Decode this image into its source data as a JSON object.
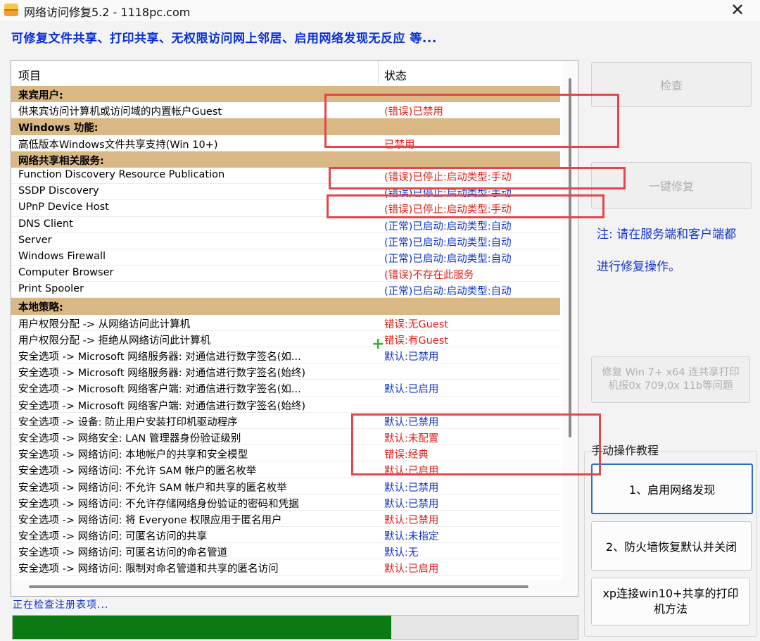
{
  "window": {
    "title": "网络访问修复5.2 - 1118pc.com",
    "close_glyph": "✕"
  },
  "subtitle": "可修复文件共享、打印共享、无权限访问网上邻居、启用网络发现无反应  等...",
  "list": {
    "columns": {
      "item": "项目",
      "status": "状态"
    },
    "rows": [
      {
        "type": "group",
        "item": "来宾用户:",
        "status": "",
        "color": ""
      },
      {
        "type": "row",
        "item": "供来宾访问计算机或访问域的内置帐户Guest",
        "status": "(错误)已禁用",
        "color": "red"
      },
      {
        "type": "group",
        "item": "Windows 功能:",
        "status": "",
        "color": ""
      },
      {
        "type": "row",
        "item": "高低版本Windows文件共享支持(Win 10+)",
        "status": "已禁用",
        "color": "red"
      },
      {
        "type": "group",
        "item": "网络共享相关服务:",
        "status": "",
        "color": ""
      },
      {
        "type": "row",
        "item": "Function Discovery Resource Publication",
        "status": "(错误)已停止:启动类型:手动",
        "color": "red"
      },
      {
        "type": "row",
        "item": "SSDP Discovery",
        "status": "(错误)已停止:启动类型:手动",
        "color": "blue"
      },
      {
        "type": "row",
        "item": "UPnP Device Host",
        "status": "(错误)已停止:启动类型:手动",
        "color": "red"
      },
      {
        "type": "row",
        "item": "DNS Client",
        "status": "(正常)已启动:启动类型:自动",
        "color": "blue"
      },
      {
        "type": "row",
        "item": "Server",
        "status": "(正常)已启动:启动类型:自动",
        "color": "blue"
      },
      {
        "type": "row",
        "item": "Windows Firewall",
        "status": "(正常)已启动:启动类型:自动",
        "color": "blue"
      },
      {
        "type": "row",
        "item": "Computer Browser",
        "status": "(错误)不存在此服务",
        "color": "red"
      },
      {
        "type": "row",
        "item": "Print Spooler",
        "status": "(正常)已启动:启动类型:自动",
        "color": "blue"
      },
      {
        "type": "group",
        "item": "本地策略:",
        "status": "",
        "color": ""
      },
      {
        "type": "row",
        "item": "用户权限分配 -> 从网络访问此计算机",
        "status": "错误:无Guest",
        "color": "red"
      },
      {
        "type": "row",
        "item": "用户权限分配 -> 拒绝从网络访问此计算机",
        "status": "错误:有Guest",
        "color": "red"
      },
      {
        "type": "row",
        "item": "安全选项 -> Microsoft 网络服务器: 对通信进行数字签名(如...",
        "status": "默认:已禁用",
        "color": "blue"
      },
      {
        "type": "row",
        "item": "安全选项 -> Microsoft 网络服务器: 对通信进行数字签名(始终)",
        "status": "",
        "color": ""
      },
      {
        "type": "row",
        "item": "安全选项 -> Microsoft 网络客户端: 对通信进行数字签名(如...",
        "status": "默认:已启用",
        "color": "blue"
      },
      {
        "type": "row",
        "item": "安全选项 -> Microsoft 网络客户端: 对通信进行数字签名(始终)",
        "status": "",
        "color": ""
      },
      {
        "type": "row",
        "item": "安全选项 -> 设备: 防止用户安装打印机驱动程序",
        "status": "默认:已禁用",
        "color": "blue"
      },
      {
        "type": "row",
        "item": "安全选项 -> 网络安全: LAN 管理器身份验证级别",
        "status": "默认:未配置",
        "color": "red"
      },
      {
        "type": "row",
        "item": "安全选项 -> 网络访问: 本地帐户的共享和安全模型",
        "status": "错误:经典",
        "color": "red"
      },
      {
        "type": "row",
        "item": "安全选项 -> 网络访问: 不允许 SAM 帐户的匿名枚举",
        "status": "默认:已启用",
        "color": "red"
      },
      {
        "type": "row",
        "item": "安全选项 -> 网络访问: 不允许 SAM 帐户和共享的匿名枚举",
        "status": "默认:已禁用",
        "color": "blue"
      },
      {
        "type": "row",
        "item": "安全选项 -> 网络访问: 不允许存储网络身份验证的密码和凭据",
        "status": "默认:已禁用",
        "color": "blue"
      },
      {
        "type": "row",
        "item": "安全选项 -> 网络访问: 将 Everyone 权限应用于匿名用户",
        "status": "默认:已禁用",
        "color": "red"
      },
      {
        "type": "row",
        "item": "安全选项 -> 网络访问: 可匿名访问的共享",
        "status": "默认:未指定",
        "color": "blue"
      },
      {
        "type": "row",
        "item": "安全选项 -> 网络访问: 可匿名访问的命名管道",
        "status": "默认:无",
        "color": "blue"
      },
      {
        "type": "row",
        "item": "安全选项 -> 网络访问: 限制对命名管道和共享的匿名访问",
        "status": "默认:已启用",
        "color": "red"
      }
    ]
  },
  "status_text": "正在检查注册表项...",
  "progress_percent": 67,
  "buttons": {
    "check": "检查",
    "one_click_fix": "一键修复",
    "fix_printer": "修复 Win 7+ x64 连共享打印机报0x 709,0x 11b等问题",
    "group_label": "手动操作教程",
    "tutorial_1": "1、启用网络发现",
    "tutorial_2": "2、防火墙恢复默认并关闭",
    "tutorial_3": "xp连接win10+共享的打印机方法"
  },
  "note": "注: 请在服务端和客户端都进行修复操作。",
  "colors": {
    "red": "#e0201a",
    "blue": "#1236c8",
    "group_bg": "#d9b886",
    "progress": "#0b7a12",
    "highlight": "#e4474b"
  }
}
